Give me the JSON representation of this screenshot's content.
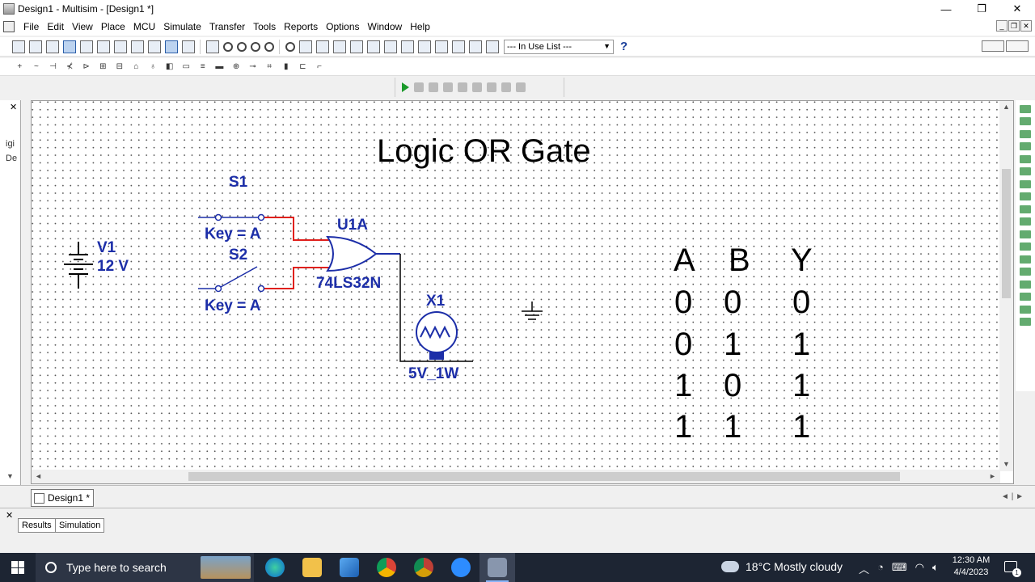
{
  "window": {
    "title": "Design1 - Multisim - [Design1 *]",
    "minimize": "—",
    "restore": "❐",
    "close": "✕"
  },
  "menu": [
    "File",
    "Edit",
    "View",
    "Place",
    "MCU",
    "Simulate",
    "Transfer",
    "Tools",
    "Reports",
    "Options",
    "Window",
    "Help"
  ],
  "toolbar": {
    "in_use_list": "--- In Use List ---",
    "help": "?"
  },
  "left_panel": {
    "close": "✕",
    "text1": "igi",
    "text2": "De"
  },
  "schematic": {
    "title": "Logic OR Gate",
    "s1_label": "S1",
    "s1_key": "Key = A",
    "s2_label": "S2",
    "s2_key": "Key = A",
    "gate_ref": "U1A",
    "gate_part": "74LS32N",
    "v1_ref": "V1",
    "v1_value": "12 V",
    "lamp_ref": "X1",
    "lamp_value": "5V_1W",
    "truth_table": {
      "headers": [
        "A",
        "B",
        "Y"
      ],
      "rows": [
        [
          "0",
          "0",
          "0"
        ],
        [
          "0",
          "1",
          "1"
        ],
        [
          "1",
          "0",
          "1"
        ],
        [
          "1",
          "1",
          "1"
        ]
      ]
    }
  },
  "tabs": {
    "design": "Design1 *",
    "results": "Results",
    "simulation": "Simulation"
  },
  "taskbar": {
    "search_placeholder": "Type here to search",
    "weather": "18°C  Mostly cloudy",
    "time": "12:30 AM",
    "date": "4/4/2023",
    "notification_count": "1"
  }
}
